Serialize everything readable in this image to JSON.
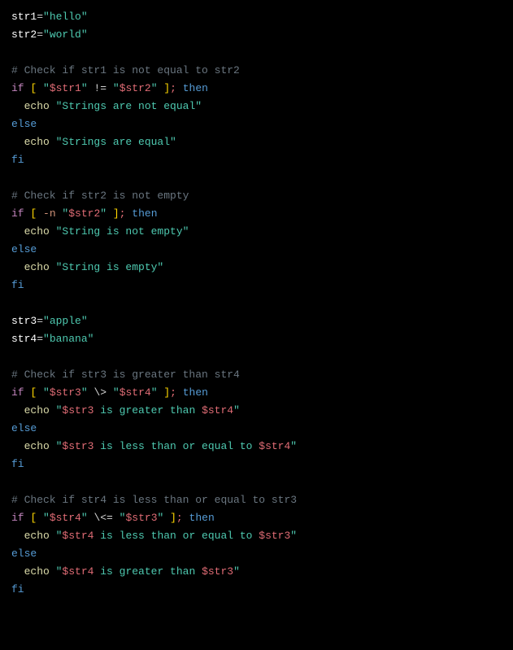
{
  "lines": {
    "l1_var": "str1",
    "l1_eq": "=",
    "l1_val": "\"hello\"",
    "l2_var": "str2",
    "l2_eq": "=",
    "l2_val": "\"world\"",
    "l4_cmt": "# Check if str1 is not equal to str2",
    "l5_if": "if",
    "l5_lb": " [ ",
    "l5_q1": "\"",
    "l5_v1": "$str1",
    "l5_q2": "\"",
    "l5_ne": " != ",
    "l5_q3": "\"",
    "l5_v2": "$str2",
    "l5_q4": "\"",
    "l5_rb": " ]",
    "l5_semi": ";",
    "l5_then": " then",
    "l6_echo": "  echo",
    "l6_str": " \"Strings are not equal\"",
    "l7_else": "else",
    "l8_echo": "  echo",
    "l8_str": " \"Strings are equal\"",
    "l9_fi": "fi",
    "l11_cmt": "# Check if str2 is not empty",
    "l12_if": "if",
    "l12_lb": " [ ",
    "l12_flag": "-n ",
    "l12_q1": "\"",
    "l12_v1": "$str2",
    "l12_q2": "\"",
    "l12_rb": " ]",
    "l12_semi": ";",
    "l12_then": " then",
    "l13_echo": "  echo",
    "l13_str": " \"String is not empty\"",
    "l14_else": "else",
    "l15_echo": "  echo",
    "l15_str": " \"String is empty\"",
    "l16_fi": "fi",
    "l18_var": "str3",
    "l18_eq": "=",
    "l18_val": "\"apple\"",
    "l19_var": "str4",
    "l19_eq": "=",
    "l19_val": "\"banana\"",
    "l21_cmt": "# Check if str3 is greater than str4",
    "l22_if": "if",
    "l22_lb": " [ ",
    "l22_q1": "\"",
    "l22_v1": "$str3",
    "l22_q2": "\"",
    "l22_op": " \\> ",
    "l22_q3": "\"",
    "l22_v2": "$str4",
    "l22_q4": "\"",
    "l22_rb": " ]",
    "l22_semi": ";",
    "l22_then": " then",
    "l23_echo": "  echo",
    "l23_p1": " \"",
    "l23_v1": "$str3",
    "l23_p2": " is greater than ",
    "l23_v2": "$str4",
    "l23_p3": "\"",
    "l24_else": "else",
    "l25_echo": "  echo",
    "l25_p1": " \"",
    "l25_v1": "$str3",
    "l25_p2": " is less than or equal to ",
    "l25_v2": "$str4",
    "l25_p3": "\"",
    "l26_fi": "fi",
    "l28_cmt": "# Check if str4 is less than or equal to str3",
    "l29_if": "if",
    "l29_lb": " [ ",
    "l29_q1": "\"",
    "l29_v1": "$str4",
    "l29_q2": "\"",
    "l29_op": " \\<= ",
    "l29_q3": "\"",
    "l29_v2": "$str3",
    "l29_q4": "\"",
    "l29_rb": " ]",
    "l29_semi": ";",
    "l29_then": " then",
    "l30_echo": "  echo",
    "l30_p1": " \"",
    "l30_v1": "$str4",
    "l30_p2": " is less than or equal to ",
    "l30_v2": "$str3",
    "l30_p3": "\"",
    "l31_else": "else",
    "l32_echo": "  echo",
    "l32_p1": " \"",
    "l32_v1": "$str4",
    "l32_p2": " is greater than ",
    "l32_v2": "$str3",
    "l32_p3": "\"",
    "l33_fi": "fi"
  }
}
